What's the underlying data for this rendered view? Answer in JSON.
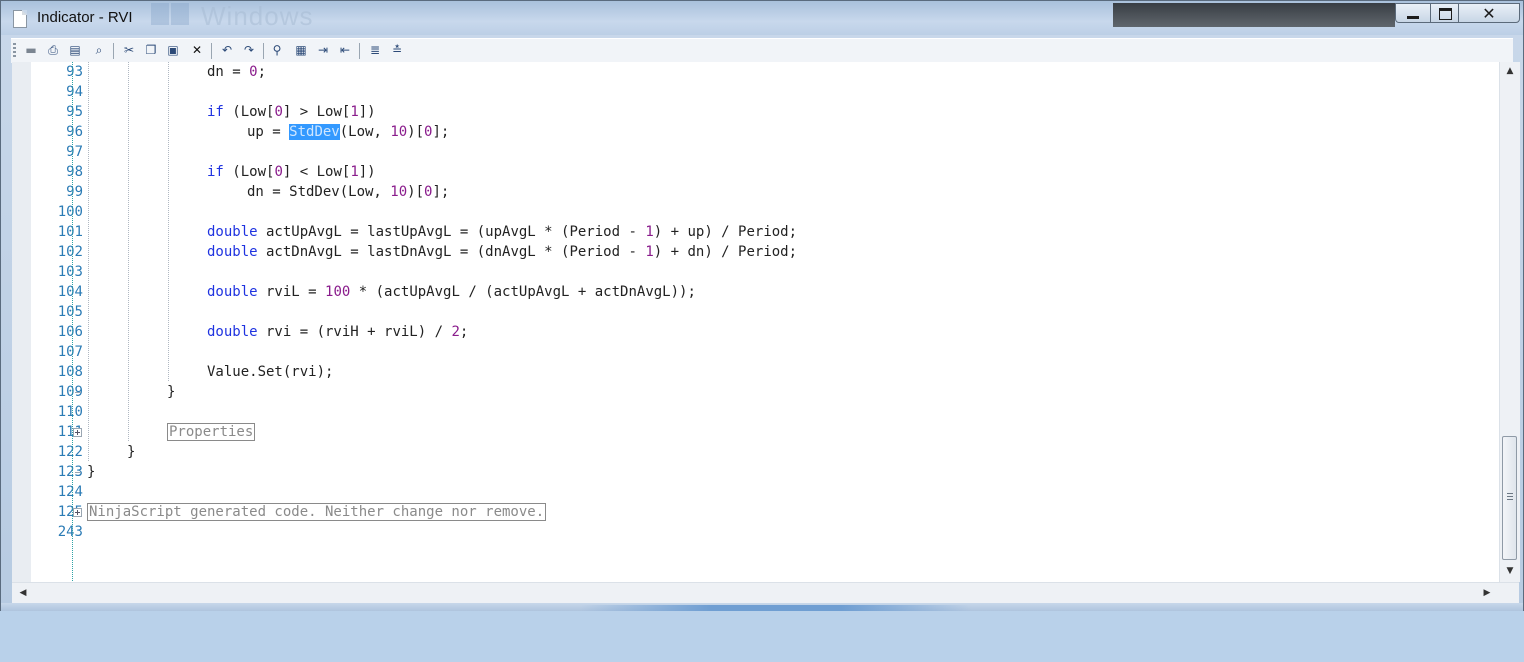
{
  "window": {
    "title": "Indicator - RVI",
    "background_watermark": "Windows",
    "controls": {
      "minimize": "minimize",
      "maximize": "maximize",
      "close": "✕"
    }
  },
  "toolbar": {
    "items": [
      "save-icon",
      "print-icon",
      "print-preview-icon",
      "find-icon",
      "cut-icon",
      "copy-icon",
      "paste-icon",
      "delete-icon",
      "undo-icon",
      "redo-icon",
      "find-binoculars-icon",
      "toggle-bookmark-icon",
      "indent-icon",
      "outdent-icon",
      "comment-icon",
      "uncomment-icon"
    ]
  },
  "editor": {
    "line_numbers": [
      "93",
      "94",
      "95",
      "96",
      "97",
      "98",
      "99",
      "100",
      "101",
      "102",
      "103",
      "104",
      "105",
      "106",
      "107",
      "108",
      "109",
      "110",
      "111",
      "122",
      "123",
      "124",
      "125",
      "243"
    ],
    "code": {
      "l93_a": "dn = ",
      "l93_b": "0",
      "l93_c": ";",
      "l95_kw": "if",
      "l95_a": " (Low[",
      "l95_b": "0",
      "l95_c": "] > Low[",
      "l95_d": "1",
      "l95_e": "])",
      "l96_a": "up = ",
      "l96_sel": "StdDev",
      "l96_b": "(Low, ",
      "l96_c": "10",
      "l96_d": ")[",
      "l96_e": "0",
      "l96_f": "];",
      "l98_kw": "if",
      "l98_a": " (Low[",
      "l98_b": "0",
      "l98_c": "] < Low[",
      "l98_d": "1",
      "l98_e": "])",
      "l99_a": "dn = StdDev(Low, ",
      "l99_b": "10",
      "l99_c": ")[",
      "l99_d": "0",
      "l99_e": "];",
      "l101_kw": "double",
      "l101_a": " actUpAvgL = lastUpAvgL = (upAvgL * (Period - ",
      "l101_b": "1",
      "l101_c": ") + up) / Period;",
      "l102_kw": "double",
      "l102_a": " actDnAvgL = lastDnAvgL = (dnAvgL * (Period - ",
      "l102_b": "1",
      "l102_c": ") + dn) / Period;",
      "l104_kw": "double",
      "l104_a": " rviL = ",
      "l104_b": "100",
      "l104_c": " * (actUpAvgL / (actUpAvgL + actDnAvgL));",
      "l106_kw": "double",
      "l106_a": " rvi = (rviH + rviL) / ",
      "l106_b": "2",
      "l106_c": ";",
      "l108": "Value.Set(rvi);",
      "l109": "}",
      "l111_region": "Properties",
      "l122": "}",
      "l123": "}",
      "l125_region": "NinjaScript generated code. Neither change nor remove."
    }
  },
  "scrollbars": {
    "up": "▲",
    "down": "▼",
    "left": "◀",
    "right": "▶"
  }
}
